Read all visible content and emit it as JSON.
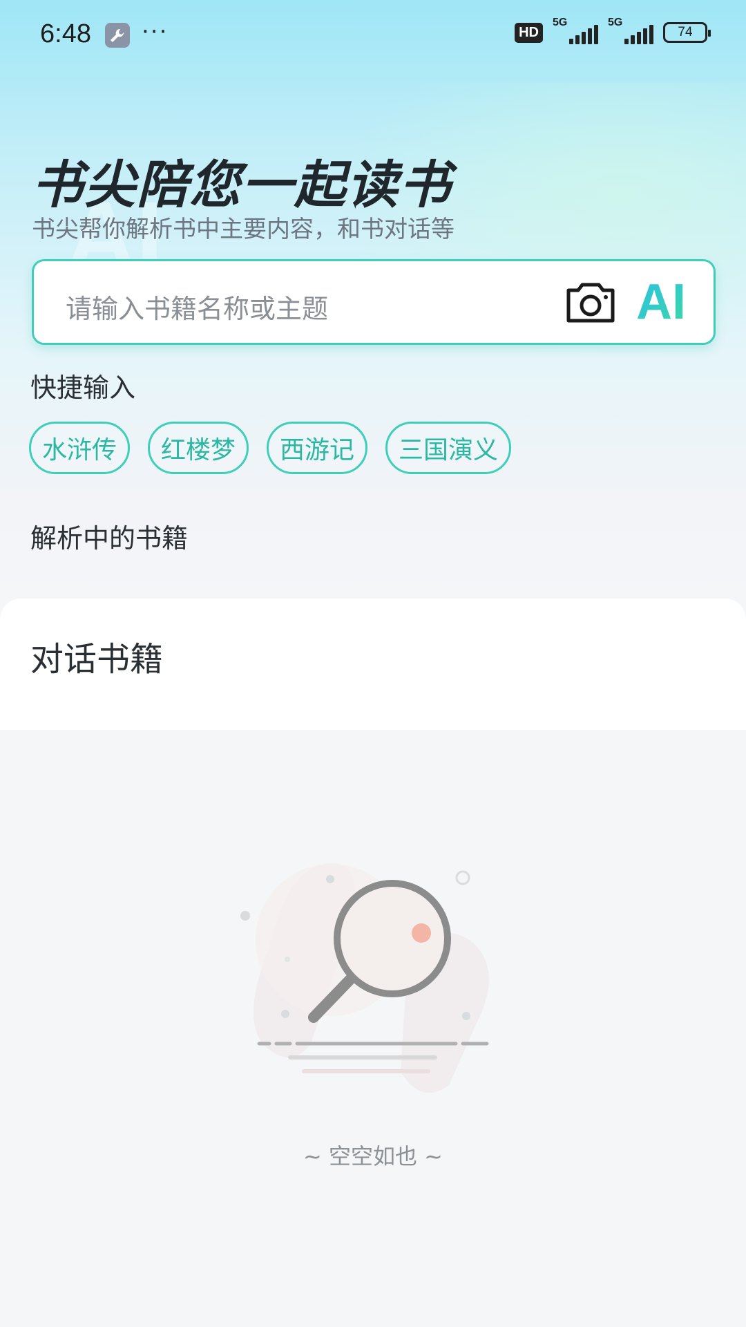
{
  "status_bar": {
    "time": "6:48",
    "more": "···",
    "hd_badge": "HD",
    "signal_1": "5G",
    "signal_2": "5G",
    "battery": "74"
  },
  "header": {
    "title": "书尖陪您一起读书",
    "subtitle": "书尖帮你解析书中主要内容，和书对话等",
    "watermark": "AI"
  },
  "search": {
    "placeholder": "请输入书籍名称或主题",
    "ai_label": "AI"
  },
  "quick_input": {
    "label": "快捷输入",
    "chips": [
      "水浒传",
      "红楼梦",
      "西游记",
      "三国演义"
    ]
  },
  "parsing": {
    "label": "解析中的书籍"
  },
  "conversation": {
    "title": "对话书籍",
    "empty_text": "~ 空空如也 ~"
  },
  "colors": {
    "accent": "#3fcfb8",
    "chip_text": "#2bb8a2",
    "ai_gradient_start": "#2bc0e4",
    "ai_gradient_end": "#3fd6a5"
  },
  "icons": [
    "wrench-icon",
    "camera-icon",
    "magnifier-empty-icon"
  ]
}
